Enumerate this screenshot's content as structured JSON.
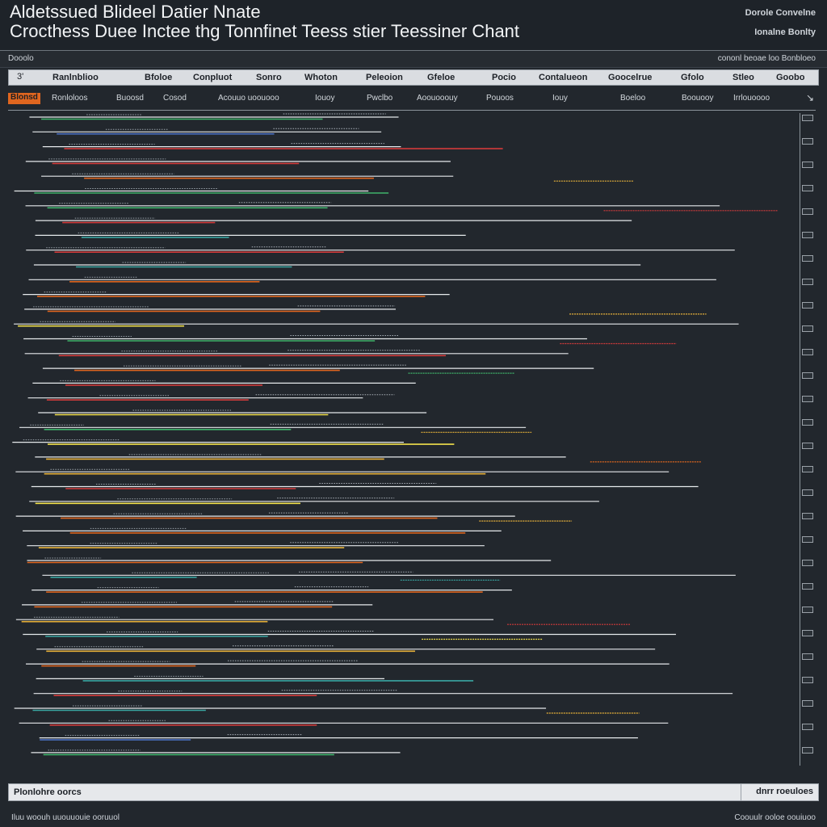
{
  "header": {
    "title_line1": "Aldetssued Blideel Datier Nnate",
    "title_line2": "Crocthess Duee Inctee thg Tonnfinet Teess stier Teessiner Chant",
    "right_line1": "Dorole Convelne",
    "right_line2": "Ionalne Bonlty"
  },
  "subbar": {
    "left": "Dooolo",
    "right": "cononl beoae loo Bonbloeo"
  },
  "columns": {
    "collapse": "3'",
    "labels": [
      "Ranlnblioo",
      "Bfoloe",
      "Conpluot",
      "Sonro",
      "Whoton",
      "Peleoion",
      "Gfeloe",
      "Pocio",
      "Contalueon",
      "Goocelrue",
      "Gfolo",
      "Stleo",
      "Goobo"
    ]
  },
  "toolrow": {
    "tag": "Blonsd",
    "labels": [
      "Ronloloos",
      "Buoosd",
      "Cosod",
      "Acouuo uoouooo",
      "Iouoy",
      "Pwclbo",
      "Aoouooouy",
      "Pouoos",
      "Iouy",
      "Boeloo",
      "Boouooy",
      "Irrlouoooo"
    ]
  },
  "footer": {
    "left": "Plonlohre oorcs",
    "right": "dnrr roeuloes"
  },
  "status": {
    "left": "Iluu woouh   uuouuouie ooruuol",
    "right": "Coouulr ooloe oouiuoo"
  },
  "colors": {
    "background": "#22272d",
    "line_white": "#e6e9ec",
    "orange": "#e0661f",
    "amber": "#e8b23a",
    "yellow": "#f1e04b",
    "green": "#3fb36b",
    "teal": "#3aa7a3",
    "blue": "#4a6fbf",
    "red": "#d23b3b"
  }
}
